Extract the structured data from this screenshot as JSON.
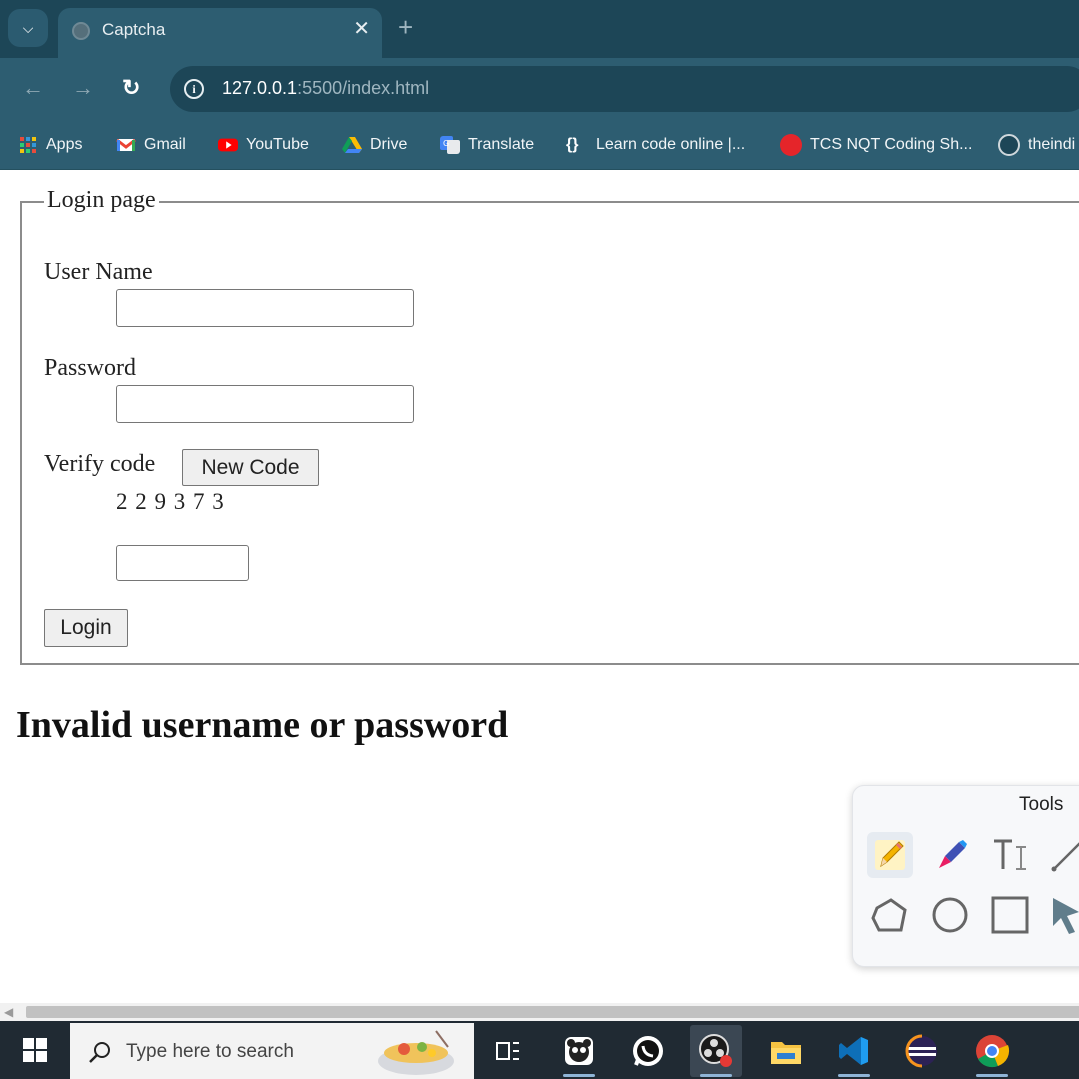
{
  "browser": {
    "tab_title": "Captcha",
    "url_host": "127.0.0.1",
    "url_rest": ":5500/index.html",
    "bookmarks": [
      {
        "label": "Apps",
        "icon": "apps-grid-icon"
      },
      {
        "label": "Gmail",
        "icon": "gmail-icon"
      },
      {
        "label": "YouTube",
        "icon": "youtube-icon"
      },
      {
        "label": "Drive",
        "icon": "drive-icon"
      },
      {
        "label": "Translate",
        "icon": "translate-icon"
      },
      {
        "label": "Learn code online |...",
        "icon": "code-icon"
      },
      {
        "label": "TCS NQT Coding Sh...",
        "icon": "prep-icon"
      },
      {
        "label": "theindi",
        "icon": "github-icon"
      }
    ]
  },
  "page": {
    "legend": "Login page",
    "username_label": "User Name",
    "username_value": "",
    "password_label": "Password",
    "password_value": "",
    "verify_label": "Verify code",
    "new_code_button": "New Code",
    "captcha_code": "2 2 9 3 7 3",
    "verify_value": "",
    "login_button": "Login",
    "error_message": "Invalid username or password"
  },
  "tools_panel": {
    "title": "Tools",
    "tools": [
      "pencil-icon",
      "marker-icon",
      "text-icon",
      "line-icon",
      "polygon-icon",
      "circle-icon",
      "rectangle-icon",
      "pointer-icon"
    ]
  },
  "taskbar": {
    "search_placeholder": "Type here to search",
    "apps": [
      "task-view-icon",
      "panda-app-icon",
      "whatsapp-icon",
      "obs-icon",
      "file-explorer-icon",
      "vscode-icon",
      "eclipse-icon",
      "chrome-icon"
    ]
  },
  "colors": {
    "tabstrip": "#1d4657",
    "toolbar": "#2d5d71",
    "taskbar": "#202a33"
  }
}
